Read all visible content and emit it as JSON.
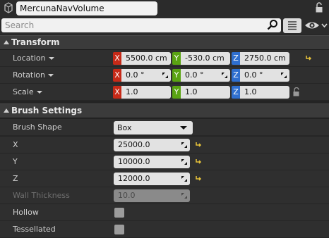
{
  "header": {
    "actor_name": "MercunaNavVolume"
  },
  "search": {
    "placeholder": "Search"
  },
  "transform": {
    "title": "Transform",
    "location": {
      "label": "Location",
      "x": "5500.0 cm",
      "y": "-530.0 cm",
      "z": "2750.0 cm"
    },
    "rotation": {
      "label": "Rotation",
      "x": "0.0 °",
      "y": "0.0 °",
      "z": "0.0 °"
    },
    "scale": {
      "label": "Scale",
      "x": "1.0",
      "y": "1.0",
      "z": "1.0"
    },
    "axis_labels": {
      "x": "X",
      "y": "Y",
      "z": "Z"
    }
  },
  "brush": {
    "title": "Brush Settings",
    "shape_label": "Brush Shape",
    "shape_value": "Box",
    "x_label": "X",
    "x_value": "25000.0",
    "y_label": "Y",
    "y_value": "10000.0",
    "z_label": "Z",
    "z_value": "12000.0",
    "wall_label": "Wall Thickness",
    "wall_value": "10.0",
    "hollow_label": "Hollow",
    "tess_label": "Tessellated"
  },
  "colors": {
    "x_axis": "#c62a18",
    "y_axis": "#5aa412",
    "z_axis": "#2f6fcf",
    "reset_arrow": "#e8c43a"
  },
  "icons": [
    "actor-icon",
    "lock-icon",
    "search-icon",
    "view-options-icon",
    "eye-icon",
    "reset-arrow-icon",
    "spin-icon"
  ]
}
